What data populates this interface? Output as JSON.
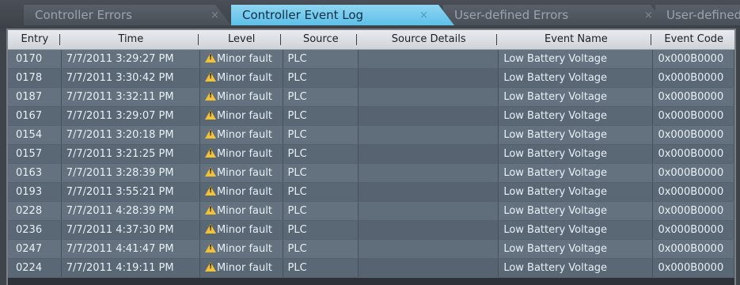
{
  "tabs": [
    {
      "label": "Controller Errors",
      "close": "×",
      "active": false
    },
    {
      "label": "Controller Event Log",
      "close": "×",
      "active": true
    },
    {
      "label": "User-defined Errors",
      "close": "×",
      "active": false
    },
    {
      "label": "User-defined",
      "active": false
    }
  ],
  "table": {
    "columns": [
      "Entry",
      "Time",
      "Level",
      "Source",
      "Source Details",
      "Event Name",
      "Event Code"
    ],
    "rows": [
      {
        "entry": "0170",
        "time": "7/7/2011 3:29:27 PM",
        "level": "Minor fault",
        "source": "PLC",
        "source_details": "",
        "event_name": "Low Battery Voltage",
        "event_code": "0x000B0000"
      },
      {
        "entry": "0178",
        "time": "7/7/2011 3:30:42 PM",
        "level": "Minor fault",
        "source": "PLC",
        "source_details": "",
        "event_name": "Low Battery Voltage",
        "event_code": "0x000B0000"
      },
      {
        "entry": "0187",
        "time": "7/7/2011 3:32:11 PM",
        "level": "Minor fault",
        "source": "PLC",
        "source_details": "",
        "event_name": "Low Battery Voltage",
        "event_code": "0x000B0000"
      },
      {
        "entry": "0167",
        "time": "7/7/2011 3:29:07 PM",
        "level": "Minor fault",
        "source": "PLC",
        "source_details": "",
        "event_name": "Low Battery Voltage",
        "event_code": "0x000B0000"
      },
      {
        "entry": "0154",
        "time": "7/7/2011 3:20:18 PM",
        "level": "Minor fault",
        "source": "PLC",
        "source_details": "",
        "event_name": "Low Battery Voltage",
        "event_code": "0x000B0000"
      },
      {
        "entry": "0157",
        "time": "7/7/2011 3:21:25 PM",
        "level": "Minor fault",
        "source": "PLC",
        "source_details": "",
        "event_name": "Low Battery Voltage",
        "event_code": "0x000B0000"
      },
      {
        "entry": "0163",
        "time": "7/7/2011 3:28:39 PM",
        "level": "Minor fault",
        "source": "PLC",
        "source_details": "",
        "event_name": "Low Battery Voltage",
        "event_code": "0x000B0000"
      },
      {
        "entry": "0193",
        "time": "7/7/2011 3:55:21 PM",
        "level": "Minor fault",
        "source": "PLC",
        "source_details": "",
        "event_name": "Low Battery Voltage",
        "event_code": "0x000B0000"
      },
      {
        "entry": "0228",
        "time": "7/7/2011 4:28:39 PM",
        "level": "Minor fault",
        "source": "PLC",
        "source_details": "",
        "event_name": "Low Battery Voltage",
        "event_code": "0x000B0000"
      },
      {
        "entry": "0236",
        "time": "7/7/2011 4:37:30 PM",
        "level": "Minor fault",
        "source": "PLC",
        "source_details": "",
        "event_name": "Low Battery Voltage",
        "event_code": "0x000B0000"
      },
      {
        "entry": "0247",
        "time": "7/7/2011 4:41:47 PM",
        "level": "Minor fault",
        "source": "PLC",
        "source_details": "",
        "event_name": "Low Battery Voltage",
        "event_code": "0x000B0000"
      },
      {
        "entry": "0224",
        "time": "7/7/2011 4:19:11 PM",
        "level": "Minor fault",
        "source": "PLC",
        "source_details": "",
        "event_name": "Low Battery Voltage",
        "event_code": "0x000B0000"
      }
    ]
  },
  "icons": {
    "level_icon": "warning-triangle-icon"
  },
  "colors": {
    "active_tab": "#6cc8ec",
    "row_bg": "#64727f",
    "warning": "#f2c233"
  }
}
